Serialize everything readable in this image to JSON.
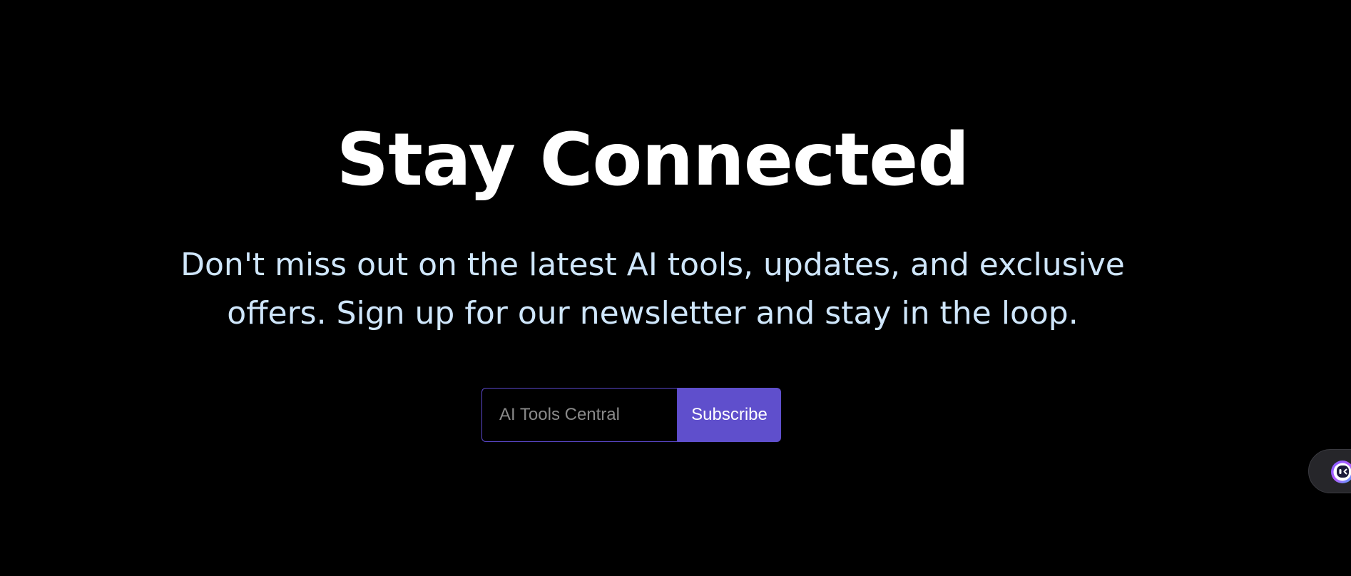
{
  "newsletter": {
    "title": "Stay Connected",
    "description_line1": "Don't miss out on the latest AI tools, updates, and exclusive",
    "description_line2": "offers. Sign up for our newsletter and stay in the loop.",
    "email_placeholder": "AI Tools Central",
    "subscribe_label": "Subscribe"
  },
  "assistant_widget": {
    "icon": "assistant-face-icon"
  },
  "colors": {
    "background": "#000000",
    "title": "#ffffff",
    "description": "#cfe6fb",
    "accent": "#5f4fcc",
    "input_border": "#5a47c9"
  }
}
